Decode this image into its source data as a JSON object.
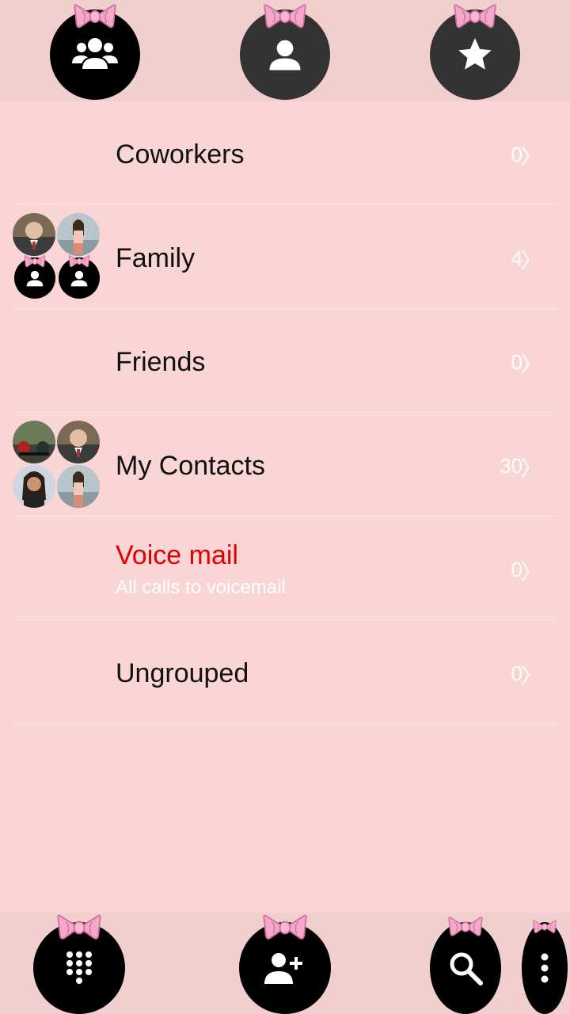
{
  "colors": {
    "background": "#f9d5d5",
    "bar": "#f2cfcf",
    "button_active": "#000000",
    "button_inactive": "#333333",
    "bow": "#f5a9c8",
    "voicemail": "#e00000",
    "count_text": "#ffffff"
  },
  "top_tabs": [
    {
      "name": "groups",
      "icon": "groups-icon",
      "active": true
    },
    {
      "name": "contacts",
      "icon": "person-icon",
      "active": false
    },
    {
      "name": "favorites",
      "icon": "star-icon",
      "active": false
    }
  ],
  "groups": [
    {
      "label": "Coworkers",
      "count": "0",
      "chevron": "〉",
      "avatars": []
    },
    {
      "label": "Family",
      "count": "4",
      "chevron": "〉",
      "avatars": [
        "photo-older-man",
        "photo-woman-beach",
        "placeholder-person",
        "placeholder-person"
      ]
    },
    {
      "label": "Friends",
      "count": "0",
      "chevron": "〉",
      "avatars": []
    },
    {
      "label": "My Contacts",
      "count": "30",
      "chevron": "〉",
      "avatars": [
        "photo-motorcycles",
        "photo-older-man",
        "photo-woman-dark-hair",
        "photo-woman-beach"
      ]
    },
    {
      "label": "Voice mail",
      "sublabel": "All calls to voicemail",
      "count": "0",
      "chevron": "〉",
      "avatars": []
    },
    {
      "label": "Ungrouped",
      "count": "0",
      "chevron": "〉",
      "avatars": []
    }
  ],
  "bottom_actions": [
    {
      "name": "dialpad",
      "icon": "dialpad-icon"
    },
    {
      "name": "add-contact",
      "icon": "add-person-icon"
    },
    {
      "name": "search",
      "icon": "search-icon"
    },
    {
      "name": "more",
      "icon": "more-vert-icon"
    }
  ]
}
